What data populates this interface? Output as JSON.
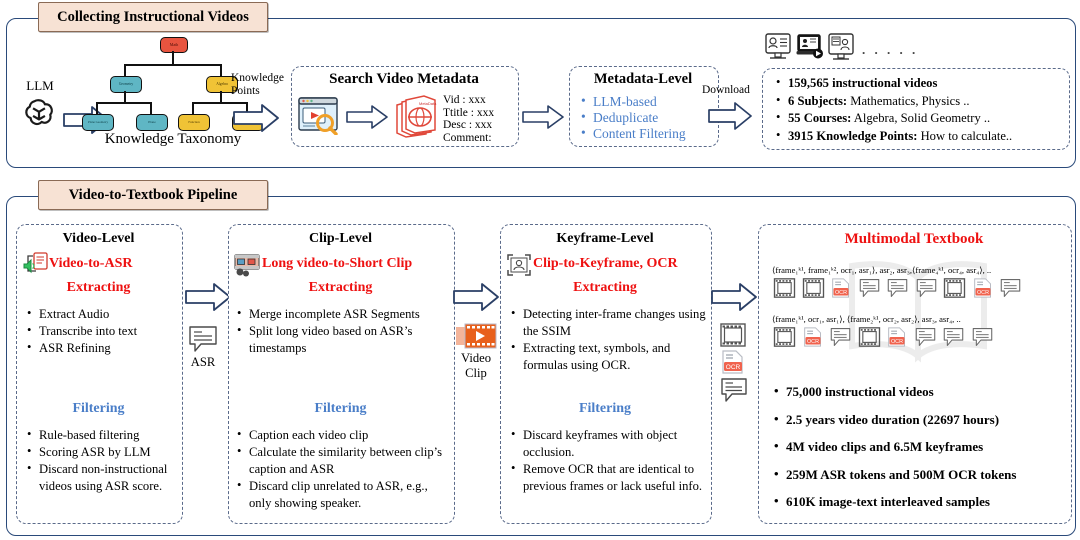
{
  "sections": {
    "top": {
      "tab": "Collecting Instructional Videos"
    },
    "bottom": {
      "tab": "Video-to-Textbook Pipeline"
    }
  },
  "top_section": {
    "llm_label": "LLM",
    "llm_icon": "openai-logo-icon",
    "taxonomy_caption": "Knowledge Taxonomy",
    "taxonomy_nodes": {
      "root": "Math",
      "level2": [
        "Geometry",
        "Algebra"
      ],
      "level3": [
        "Plane Geometry",
        "Plane",
        "Function",
        "Equation"
      ]
    },
    "knowledge_points_label": "Knowledge\nPoints",
    "search_card": {
      "title": "Search Video Metadata",
      "browser_icon": "video-search-browser-icon",
      "docs_icon": "metadata-documents-icon",
      "fields": [
        "Vid :  xxx",
        "Ttitle : xxx",
        "Desc : xxx",
        "Comment:"
      ]
    },
    "metadata_card": {
      "title": "Metadata-Level",
      "items": [
        "LLM-based",
        "Deduplicate",
        "Content Filtering"
      ]
    },
    "download_label": "Download",
    "video_icons": [
      "lecture-monitor-icon",
      "lecture-laptop-play-icon",
      "lecture-screen-icon"
    ],
    "video_icons_ellipsis": ". . . . .",
    "stats_card": {
      "items": [
        {
          "bold": "159,565 instructional videos",
          "rest": ""
        },
        {
          "bold": "6 Subjects:",
          "rest": " Mathematics, Physics .."
        },
        {
          "bold": "55 Courses:",
          "rest": " Algebra, Solid Geometry .."
        },
        {
          "bold": "3915 Knowledge Points:",
          "rest": " How to calculate.."
        }
      ]
    }
  },
  "pipeline": {
    "stages": [
      {
        "title": "Video-Level",
        "icon": "video-to-asr-icon",
        "subtitle": "Video-to-ASR",
        "extracting_label": "Extracting",
        "extracting_items": [
          "Extract Audio",
          "Transcribe into text",
          "ASR Refining"
        ],
        "filtering_label": "Filtering",
        "filtering_items": [
          "Rule-based filtering",
          "Scoring ASR by LLM",
          "Discard non-instructional videos using ASR score."
        ]
      },
      {
        "title": "Clip-Level",
        "icon": "long-video-to-short-clip-icon",
        "subtitle": "Long video-to-Short Clip",
        "extracting_label": "Extracting",
        "extracting_items": [
          "Merge incomplete ASR Segments",
          "Split long video based on ASR’s timestamps"
        ],
        "filtering_label": "Filtering",
        "filtering_items": [
          "Caption each video clip",
          "Calculate the similarity between clip’s caption and ASR",
          "Discard clip unrelated to ASR, e.g., only showing speaker."
        ]
      },
      {
        "title": "Keyframe-Level",
        "icon": "clip-to-keyframe-ocr-icon",
        "subtitle": "Clip-to-Keyframe, OCR",
        "extracting_label": "Extracting",
        "extracting_items": [
          "Detecting inter-frame changes using the SSIM",
          "Extracting text, symbols, and formulas using OCR."
        ],
        "filtering_label": "Filtering",
        "filtering_items": [
          "Discard keyframes with object occlusion.",
          "Remove OCR that are identical to previous frames or lack useful info."
        ]
      }
    ],
    "connectors": [
      {
        "label": "ASR",
        "icon": "asr-speech-bubble-icon"
      },
      {
        "label": "Video\nClip",
        "label_line1": "Video",
        "label_line2": "Clip",
        "icon": "video-clip-filmstrip-icon"
      },
      {
        "label": "",
        "icons": [
          "filmstrip-icon",
          "ocr-document-icon",
          "asr-speech-bubble-icon"
        ]
      }
    ],
    "textbook_card": {
      "title": "Multimodal Textbook",
      "sequence_1": "⟨frame₁ᵏ¹, frame₁ᵏ², ocr₁, asr₁⟩, asr₂, asr₃,⟨frame₄ᵏ¹, ocr₄, asr₄⟩, ..",
      "sequence_2": "⟨frame₁ᵏ¹, ocr₁, asr₁⟩, ⟨frame₂ᵏ¹, ocr₂, asr₂⟩, asr₃, asr₄, ..",
      "row1_icons": [
        "frame",
        "frame",
        "ocr",
        "asr",
        "asr",
        "asr",
        "frame",
        "ocr",
        "asr"
      ],
      "row2_icons": [
        "frame",
        "ocr",
        "asr",
        "frame",
        "ocr",
        "asr",
        "asr",
        "asr"
      ],
      "stats": [
        "75,000 instructional videos",
        "2.5 years video duration (22697 hours)",
        "4M video clips and 6.5M keyframes",
        "259M ASR tokens and 500M OCR tokens",
        "610K image-text interleaved samples"
      ]
    }
  },
  "colors": {
    "frame_border": "#2a4a7a",
    "tab_fill": "#f7e2d4",
    "accent_red": "#ee1111",
    "accent_blue": "#4a7ec8",
    "card_border": "#5a6a8a"
  }
}
